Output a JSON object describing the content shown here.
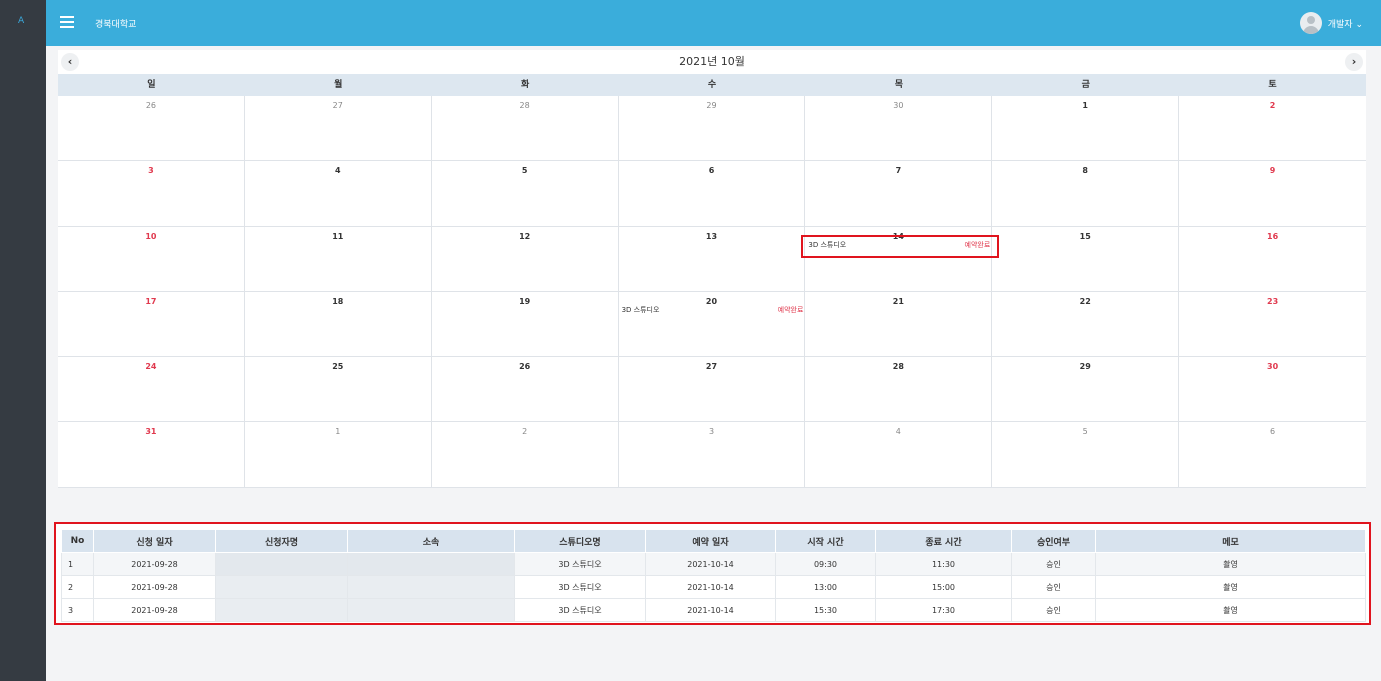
{
  "sidebar": {
    "logo": "A"
  },
  "header": {
    "org": "경북대학교",
    "user": "개발자 ⌄"
  },
  "calendar": {
    "title": "2021년 10월",
    "prev": "‹",
    "next": "›",
    "weekdays": [
      "일",
      "월",
      "화",
      "수",
      "목",
      "금",
      "토"
    ],
    "weeks": [
      [
        "26",
        "27",
        "28",
        "29",
        "30",
        "1",
        "2"
      ],
      [
        "3",
        "4",
        "5",
        "6",
        "7",
        "8",
        "9"
      ],
      [
        "10",
        "11",
        "12",
        "13",
        "14",
        "15",
        "16"
      ],
      [
        "17",
        "18",
        "19",
        "20",
        "21",
        "22",
        "23"
      ],
      [
        "24",
        "25",
        "26",
        "27",
        "28",
        "29",
        "30"
      ],
      [
        "31",
        "1",
        "2",
        "3",
        "4",
        "5",
        "6"
      ]
    ],
    "events": [
      {
        "week": 2,
        "day": 4,
        "name": "3D 스튜디오",
        "status": "예약완료"
      },
      {
        "week": 3,
        "day": 3,
        "name": "3D 스튜디오",
        "status": "예약완료"
      }
    ]
  },
  "table": {
    "headers": [
      "No",
      "신청 일자",
      "신청자명",
      "소속",
      "스튜디오명",
      "예약 일자",
      "시작 시간",
      "종료 시간",
      "승인여부",
      "메모"
    ],
    "rows": [
      [
        "1",
        "2021-09-28",
        "",
        "",
        "3D 스튜디오",
        "2021-10-14",
        "09:30",
        "11:30",
        "승인",
        "촬영"
      ],
      [
        "2",
        "2021-09-28",
        "",
        "",
        "3D 스튜디오",
        "2021-10-14",
        "13:00",
        "15:00",
        "승인",
        "촬영"
      ],
      [
        "3",
        "2021-09-28",
        "",
        "",
        "3D 스튜디오",
        "2021-10-14",
        "15:30",
        "17:30",
        "승인",
        "촬영"
      ]
    ]
  }
}
